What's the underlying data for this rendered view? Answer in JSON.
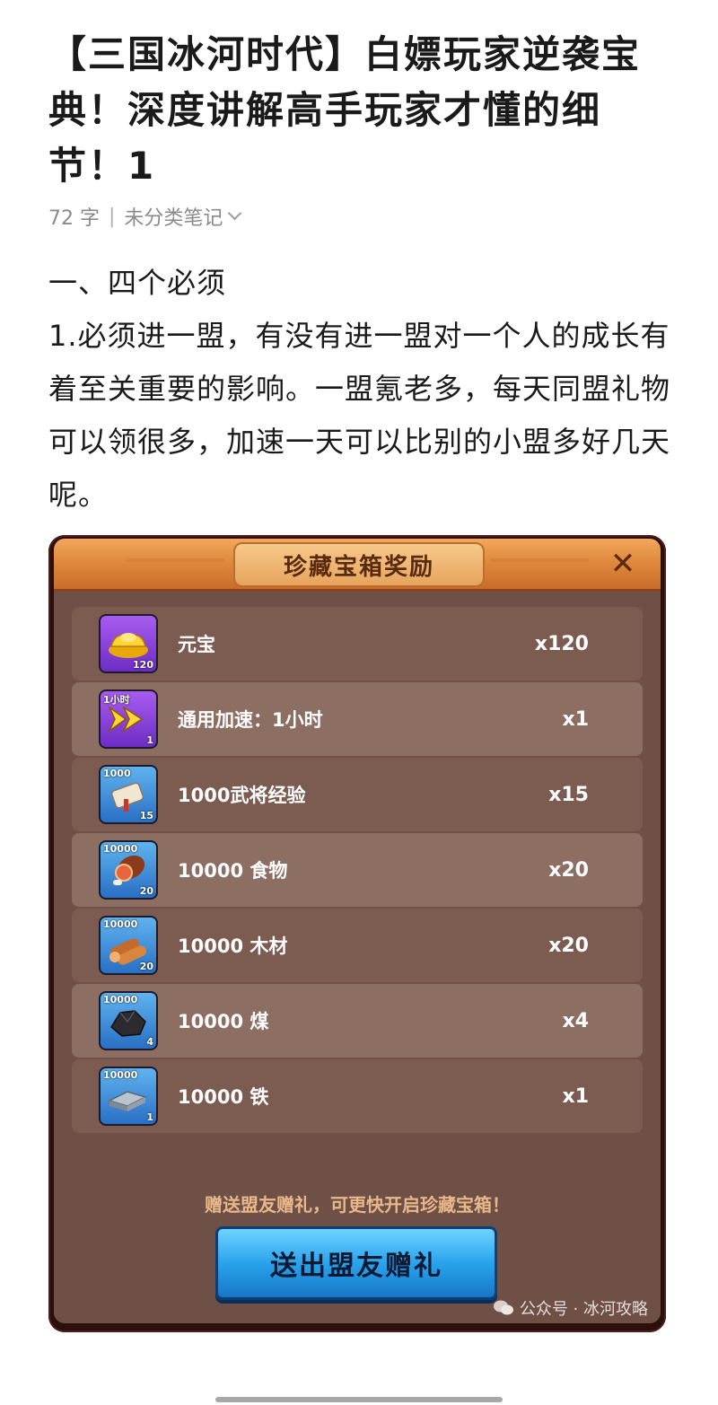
{
  "article": {
    "title": "【三国冰河时代】白嫖玩家逆袭宝典！深度讲解高手玩家才懂的细节！1",
    "word_count": "72 字",
    "separator": "|",
    "category": "未分类笔记",
    "paragraphs": [
      "一、四个必须",
      "1.必须进一盟，有没有进一盟对一个人的成长有着至关重要的影响。一盟氪老多，每天同盟礼物可以领很多，加速一天可以比别的小盟多好几天呢。"
    ]
  },
  "game_dialog": {
    "title": "珍藏宝箱奖励",
    "close_symbol": "✕",
    "rewards": [
      {
        "name": "元宝",
        "qty": "x120",
        "icon": "gold-ingot-icon",
        "frame": "purple",
        "tag": "",
        "count": "120"
      },
      {
        "name": "通用加速：1小时",
        "qty": "x1",
        "icon": "speedup-icon",
        "frame": "purple",
        "tag": "1小时",
        "count": "1"
      },
      {
        "name": "1000武将经验",
        "qty": "x15",
        "icon": "scroll-icon",
        "frame": "blue",
        "tag": "1000",
        "count": "15"
      },
      {
        "name": "10000 食物",
        "qty": "x20",
        "icon": "meat-icon",
        "frame": "blue",
        "tag": "10000",
        "count": "20"
      },
      {
        "name": "10000 木材",
        "qty": "x20",
        "icon": "wood-icon",
        "frame": "blue",
        "tag": "10000",
        "count": "20"
      },
      {
        "name": "10000 煤",
        "qty": "x4",
        "icon": "coal-icon",
        "frame": "blue",
        "tag": "10000",
        "count": "4"
      },
      {
        "name": "10000 铁",
        "qty": "x1",
        "icon": "iron-icon",
        "frame": "blue",
        "tag": "10000",
        "count": "1"
      }
    ],
    "hint": "赠送盟友赠礼，可更快开启珍藏宝箱！",
    "button_label": "送出盟友赠礼",
    "watermark": "公众号 · 冰河攻略"
  },
  "colors": {
    "panel_bg": "#6f5046",
    "header_orange": "#e08a3e",
    "button_blue": "#29a3ec",
    "hint_text": "#e8b88a"
  }
}
